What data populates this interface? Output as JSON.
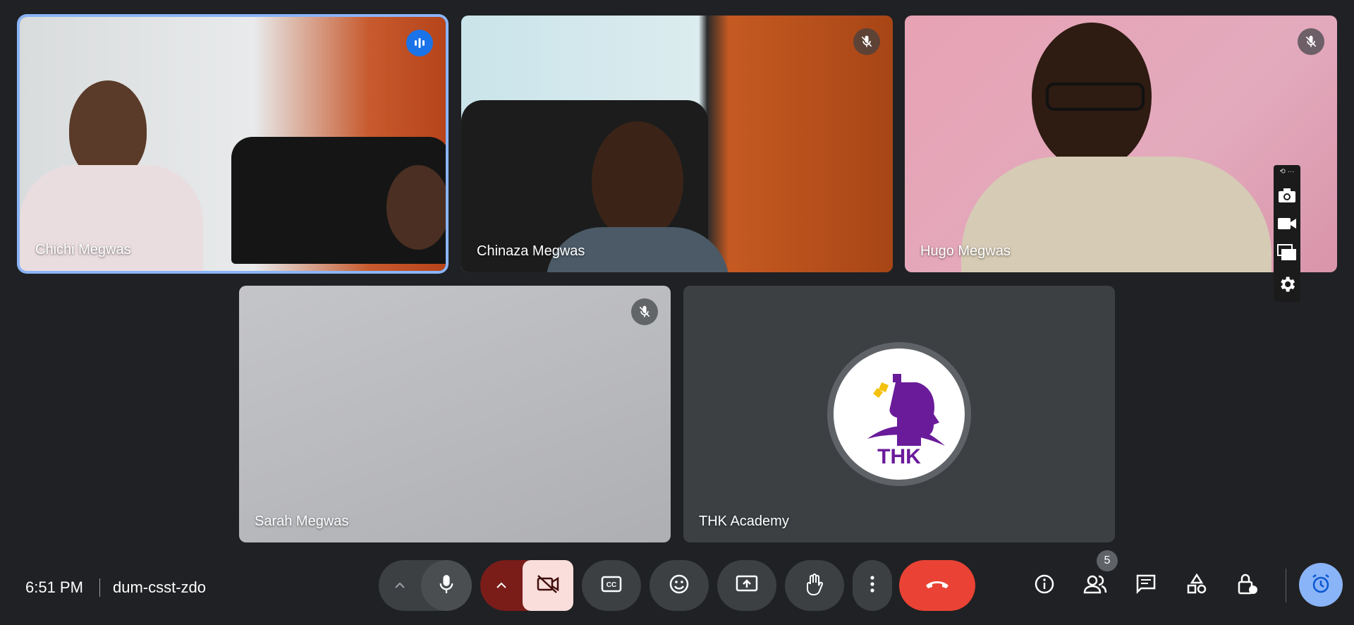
{
  "tiles": [
    {
      "name": "Chichi Megwas",
      "status_icon": "speaking-indicator-icon"
    },
    {
      "name": "Chinaza Megwas",
      "status_icon": "mic-off-icon"
    },
    {
      "name": "Hugo Megwas",
      "status_icon": "mic-off-icon"
    },
    {
      "name": "Sarah Megwas",
      "status_icon": "mic-off-icon"
    },
    {
      "name": "THK Academy",
      "avatar_text": "THK"
    }
  ],
  "meeting": {
    "time": "6:51 PM",
    "code": "dum-csst-zdo"
  },
  "participants_count": "5",
  "colors": {
    "background": "#202124",
    "tile": "#3c4043",
    "accent": "#8ab4f8",
    "end_call": "#ea4335",
    "avatar_purple": "#6a1b9a",
    "avatar_yellow": "#f4c20d"
  },
  "mini_toolbar": {
    "top": "⟲ ···",
    "icons": [
      "camera-icon",
      "video-icon",
      "window-icon",
      "settings-icon"
    ]
  },
  "controls": [
    "expand-audio-icon",
    "mic-icon",
    "expand-video-icon",
    "camera-off-icon",
    "captions-icon",
    "emoji-icon",
    "present-icon",
    "raise-hand-icon",
    "more-options-icon",
    "end-call-icon",
    "info-icon",
    "people-icon",
    "chat-icon",
    "activities-icon",
    "host-controls-icon",
    "timer-icon"
  ]
}
